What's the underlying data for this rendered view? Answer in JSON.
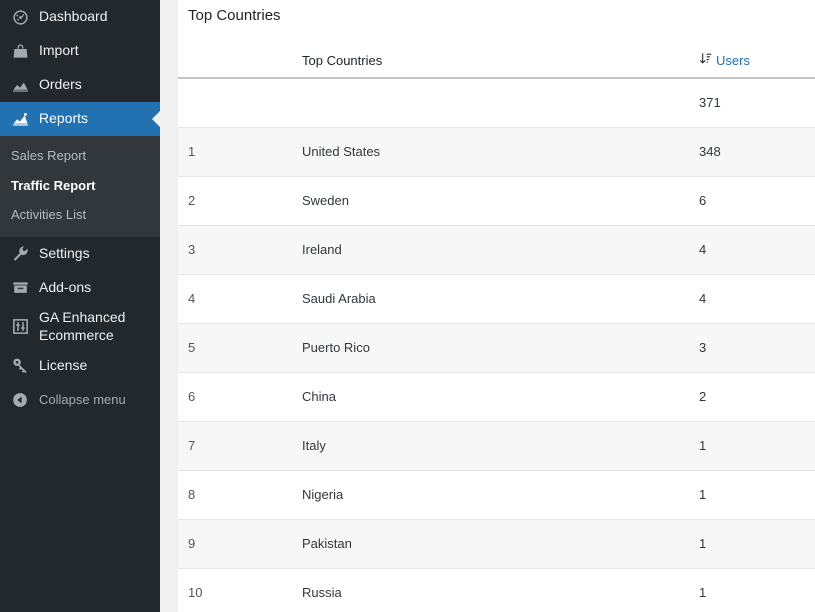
{
  "sidebar": {
    "items": [
      {
        "label": "Dashboard",
        "icon": "dashboard-icon",
        "name": "dashboard"
      },
      {
        "label": "Import",
        "icon": "import-bag-icon",
        "name": "import"
      },
      {
        "label": "Orders",
        "icon": "orders-chart-icon",
        "name": "orders"
      },
      {
        "label": "Reports",
        "icon": "reports-chart-icon",
        "name": "reports",
        "current": true
      },
      {
        "label": "Settings",
        "icon": "wrench-icon",
        "name": "settings"
      },
      {
        "label": "Add-ons",
        "icon": "box-icon",
        "name": "add-ons"
      },
      {
        "label": "GA Enhanced Ecommerce",
        "icon": "sliders-box-icon",
        "name": "ga-enhanced-ecommerce"
      },
      {
        "label": "License",
        "icon": "key-icon",
        "name": "license"
      }
    ],
    "submenu": [
      {
        "label": "Sales Report",
        "name": "sales-report"
      },
      {
        "label": "Traffic Report",
        "name": "traffic-report",
        "current": true
      },
      {
        "label": "Activities List",
        "name": "activities-list"
      }
    ],
    "collapse": {
      "label": "Collapse menu",
      "icon": "collapse-arrow-icon"
    },
    "colors": {
      "background": "#23282d",
      "submenu_background": "#32373c",
      "current_highlight": "#2271b1",
      "text": "#f0f0f1",
      "muted_text": "#a7aaad"
    }
  },
  "main": {
    "page_title": "Top Countries",
    "accent": "#2271b1"
  },
  "table": {
    "columns": {
      "rank": "",
      "name": "Top Countries",
      "users": "Users"
    },
    "sort_icon": "sort-descending-icon",
    "total_row": {
      "rank": "",
      "name": "",
      "users": "371"
    },
    "rows": [
      {
        "rank": "1",
        "name": "United States",
        "users": "348"
      },
      {
        "rank": "2",
        "name": "Sweden",
        "users": "6"
      },
      {
        "rank": "3",
        "name": "Ireland",
        "users": "4"
      },
      {
        "rank": "4",
        "name": "Saudi Arabia",
        "users": "4"
      },
      {
        "rank": "5",
        "name": "Puerto Rico",
        "users": "3"
      },
      {
        "rank": "6",
        "name": "China",
        "users": "2"
      },
      {
        "rank": "7",
        "name": "Italy",
        "users": "1"
      },
      {
        "rank": "8",
        "name": "Nigeria",
        "users": "1"
      },
      {
        "rank": "9",
        "name": "Pakistan",
        "users": "1"
      },
      {
        "rank": "10",
        "name": "Russia",
        "users": "1"
      }
    ]
  },
  "chart_data": {
    "type": "table",
    "title": "Top Countries",
    "categories": [
      "United States",
      "Sweden",
      "Ireland",
      "Saudi Arabia",
      "Puerto Rico",
      "China",
      "Italy",
      "Nigeria",
      "Pakistan",
      "Russia"
    ],
    "values": [
      348,
      6,
      4,
      4,
      3,
      2,
      1,
      1,
      1,
      1
    ],
    "series": [
      {
        "name": "Users",
        "values": [
          348,
          6,
          4,
          4,
          3,
          2,
          1,
          1,
          1,
          1
        ]
      }
    ],
    "total": 371,
    "xlabel": "Top Countries",
    "ylabel": "Users",
    "sort": "descending"
  }
}
